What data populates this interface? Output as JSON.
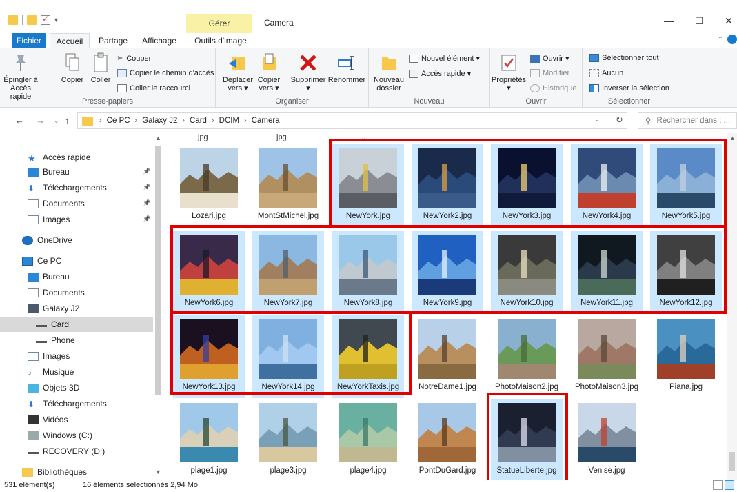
{
  "window": {
    "title": "Camera",
    "context_tab": "Gérer",
    "controls": [
      "—",
      "☐",
      "✕"
    ]
  },
  "tabs": [
    {
      "label": "Fichier"
    },
    {
      "label": "Accueil"
    },
    {
      "label": "Partage"
    },
    {
      "label": "Affichage"
    },
    {
      "label": "Outils d'image"
    }
  ],
  "ribbon": {
    "presse_papiers": {
      "label": "Presse-papiers",
      "epingler_line1": "Épingler à",
      "epingler_line2": "Accès rapide",
      "copier": "Copier",
      "coller": "Coller",
      "couper": "Couper",
      "copier_chemin": "Copier le chemin d'accès",
      "coller_raccourci": "Coller le raccourci"
    },
    "organiser": {
      "label": "Organiser",
      "deplacer_line1": "Déplacer",
      "deplacer_line2": "vers ▾",
      "copier_line1": "Copier",
      "copier_line2": "vers ▾",
      "supprimer": "Supprimer",
      "supprimer_caret": "▾",
      "renommer": "Renommer"
    },
    "nouveau": {
      "label": "Nouveau",
      "nouveau_line1": "Nouveau",
      "nouveau_line2": "dossier",
      "nouvel_element": "Nouvel élément ▾",
      "acces_rapide": "Accès rapide ▾"
    },
    "ouvrir": {
      "label": "Ouvrir",
      "proprietes": "Propriétés",
      "proprietes_caret": "▾",
      "ouvrir": "Ouvrir ▾",
      "modifier": "Modifier",
      "historique": "Historique"
    },
    "selectionner": {
      "label": "Sélectionner",
      "tout": "Sélectionner tout",
      "aucun": "Aucun",
      "inverser": "Inverser la sélection"
    }
  },
  "address": {
    "crumbs": [
      "Ce PC",
      "Galaxy J2",
      "Card",
      "DCIM",
      "Camera"
    ],
    "search_placeholder": "Rechercher dans : ..."
  },
  "sidebar": {
    "items": [
      {
        "label": "Accès rapide",
        "icon": "star-icon",
        "pinned": false
      },
      {
        "label": "Bureau",
        "icon": "desktop-icon",
        "pinned": true
      },
      {
        "label": "Téléchargements",
        "icon": "download-icon",
        "pinned": true
      },
      {
        "label": "Documents",
        "icon": "documents-icon",
        "pinned": true
      },
      {
        "label": "Images",
        "icon": "images-icon",
        "pinned": true
      },
      {
        "label": "OneDrive",
        "icon": "cloud-icon",
        "pinned": false
      },
      {
        "label": "Ce PC",
        "icon": "computer-icon",
        "pinned": false
      },
      {
        "label": "Bureau",
        "icon": "desktop-icon",
        "pinned": false
      },
      {
        "label": "Documents",
        "icon": "documents-icon",
        "pinned": false
      },
      {
        "label": "Galaxy J2",
        "icon": "phone-icon",
        "pinned": false
      },
      {
        "label": "Card",
        "icon": "drive-icon",
        "pinned": false,
        "selected": true
      },
      {
        "label": "Phone",
        "icon": "drive-icon",
        "pinned": false
      },
      {
        "label": "Images",
        "icon": "images-icon",
        "pinned": false
      },
      {
        "label": "Musique",
        "icon": "music-icon",
        "pinned": false
      },
      {
        "label": "Objets 3D",
        "icon": "cube-icon",
        "pinned": false
      },
      {
        "label": "Téléchargements",
        "icon": "download-icon",
        "pinned": false
      },
      {
        "label": "Vidéos",
        "icon": "video-icon",
        "pinned": false
      },
      {
        "label": "Windows (C:)",
        "icon": "windows-drive-icon",
        "pinned": false
      },
      {
        "label": "RECOVERY (D:)",
        "icon": "drive-icon",
        "pinned": false
      },
      {
        "label": "Bibliothèques",
        "icon": "library-icon",
        "pinned": false
      }
    ]
  },
  "content": {
    "top_partial_labels": [
      "jpg",
      "jpg",
      "..."
    ],
    "files": [
      {
        "name": "Lozari.jpg",
        "selected": false
      },
      {
        "name": "MontStMichel.jpg",
        "selected": false
      },
      {
        "name": "NewYork.jpg",
        "selected": true
      },
      {
        "name": "NewYork2.jpg",
        "selected": true
      },
      {
        "name": "NewYork3.jpg",
        "selected": true
      },
      {
        "name": "NewYork4.jpg",
        "selected": true
      },
      {
        "name": "NewYork5.jpg",
        "selected": true
      },
      {
        "name": "NewYork6.jpg",
        "selected": true
      },
      {
        "name": "NewYork7.jpg",
        "selected": true
      },
      {
        "name": "NewYork8.jpg",
        "selected": true
      },
      {
        "name": "NewYork9.jpg",
        "selected": true
      },
      {
        "name": "NewYork10.jpg",
        "selected": true
      },
      {
        "name": "NewYork11.jpg",
        "selected": true
      },
      {
        "name": "NewYork12.jpg",
        "selected": true
      },
      {
        "name": "NewYork13.jpg",
        "selected": true
      },
      {
        "name": "NewYork14.jpg",
        "selected": true
      },
      {
        "name": "NewYorkTaxis.jpg",
        "selected": true
      },
      {
        "name": "NotreDame1.jpg",
        "selected": false
      },
      {
        "name": "PhotoMaison2.jpg",
        "selected": false
      },
      {
        "name": "PhotoMaison3.jpg",
        "selected": false
      },
      {
        "name": "Piana.jpg",
        "selected": false
      },
      {
        "name": "plage1.jpg",
        "selected": false
      },
      {
        "name": "plage3.jpg",
        "selected": false
      },
      {
        "name": "plage4.jpg",
        "selected": false
      },
      {
        "name": "PontDuGard.jpg",
        "selected": false
      },
      {
        "name": "StatueLiberte.jpg",
        "selected": true
      },
      {
        "name": "Venise.jpg",
        "selected": false
      }
    ]
  },
  "status": {
    "count": "531 élément(s)",
    "selection": "16 éléments sélectionnés  2,94 Mo"
  },
  "colors": {
    "selection": "#cce8ff",
    "file_tab": "#1979ca",
    "context_tab": "#f9f1a5",
    "annotation": "#e00000"
  }
}
